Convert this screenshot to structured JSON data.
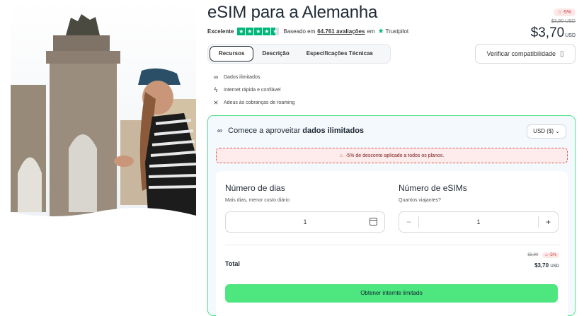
{
  "product": {
    "title": "eSIM para a Alemanha",
    "rating_label": "Excelente",
    "reviews_prefix": "Baseado em",
    "reviews_link": "64.761 avaliações",
    "reviews_suffix": "em",
    "trustpilot": "Trustpilot",
    "stars": 4.5
  },
  "price": {
    "discount_badge": "-5%",
    "old_price": "$3,90 USD",
    "new_price": "$3,70",
    "currency": "USD"
  },
  "tabs": [
    {
      "label": "Recursos",
      "active": true
    },
    {
      "label": "Descrição",
      "active": false
    },
    {
      "label": "Especificações Técnicas",
      "active": false
    }
  ],
  "compat_button": "Verificar compatibilidade",
  "features": [
    {
      "icon": "infinity-icon",
      "label": "Dados ilimitados"
    },
    {
      "icon": "lightning-icon",
      "label": "Internet rápida e confiável"
    },
    {
      "icon": "no-roaming-icon",
      "label": "Adeus às cobranças de roaming"
    }
  ],
  "plan": {
    "heading_prefix": "Comece a aproveitar",
    "heading_bold": "dados ilimitados",
    "currency_select": "USD ($)",
    "promo": "-5% de desconto aplicado a todos os planos.",
    "days_title": "Número de dias",
    "days_sub": "Mais dias, menor custo diário",
    "days_value": "1",
    "esims_title": "Número de eSIMs",
    "esims_sub": "Quantos viajantes?",
    "esims_value": "1",
    "minus": "−",
    "plus": "+",
    "total_label": "Total",
    "total_old": "$3,90",
    "total_badge": "-5%",
    "total_new": "$3,70",
    "total_currency": "USD",
    "cta": "Obtener internte limitado"
  },
  "colors": {
    "accent_green": "#4ee67f",
    "card_border": "#4ee28a",
    "trustpilot_green": "#00b67a",
    "discount_red": "#c53b3b"
  }
}
